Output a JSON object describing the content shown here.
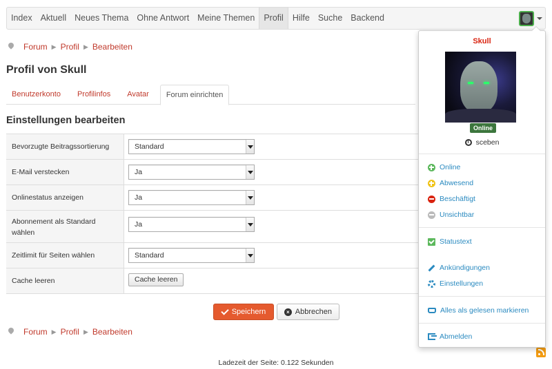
{
  "navbar": {
    "items": [
      "Index",
      "Aktuell",
      "Neues Thema",
      "Ohne Antwort",
      "Meine Themen",
      "Profil",
      "Hilfe",
      "Suche",
      "Backend"
    ],
    "active_index": 5
  },
  "breadcrumb": [
    "Forum",
    "Profil",
    "Bearbeiten"
  ],
  "page_title": "Profil von Skull",
  "tabs": [
    "Benutzerkonto",
    "Profilinfos",
    "Avatar",
    "Forum einrichten"
  ],
  "active_tab": 3,
  "section_title": "Einstellungen bearbeiten",
  "settings": [
    {
      "label": "Bevorzugte Beitragssortierung",
      "value": "Standard"
    },
    {
      "label": "E-Mail verstecken",
      "value": "Ja"
    },
    {
      "label": "Onlinestatus anzeigen",
      "value": "Ja"
    },
    {
      "label": "Abonnement als Standard wählen",
      "value": "Ja"
    },
    {
      "label": "Zeitlimit für Seiten wählen",
      "value": "Standard"
    },
    {
      "label": "Cache leeren",
      "button": "Cache leeren"
    }
  ],
  "actions": {
    "save": "Speichern",
    "cancel": "Abbrechen"
  },
  "footer": "Ladezeit der Seite: 0.122 Sekunden",
  "user_menu": {
    "username": "Skull",
    "status_badge": "Online",
    "time": "sceben",
    "status_options": [
      {
        "label": "Online",
        "color": "#5cb85c",
        "icon": "plus-circle-icon"
      },
      {
        "label": "Abwesend",
        "color": "#f0c419",
        "icon": "plus-circle-icon"
      },
      {
        "label": "Beschäftigt",
        "color": "#d9230f",
        "icon": "minus-circle-icon"
      },
      {
        "label": "Unsichtbar",
        "color": "#bbbbbb",
        "icon": "minus-circle-icon"
      }
    ],
    "status_text": "Statustext",
    "announcements": "Ankündigungen",
    "settings": "Einstellungen",
    "mark_read": "Alles als gelesen markieren",
    "logout": "Abmelden"
  },
  "colors": {
    "accent": "#c0392b",
    "primary_button": "#e55a2e",
    "link": "#2a8ac0",
    "online": "#3c763d"
  }
}
